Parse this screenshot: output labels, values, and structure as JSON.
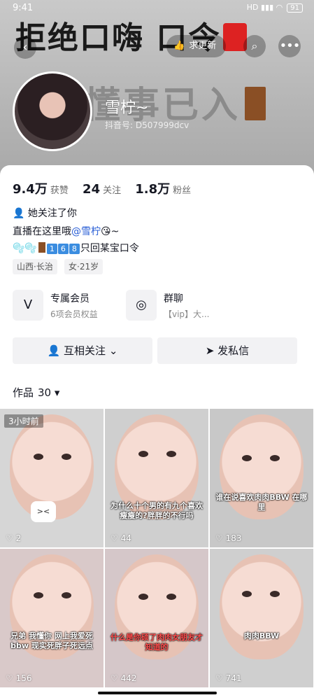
{
  "status_bar": {
    "time": "9:41",
    "signal": "HD ▮▮▮ ◠",
    "battery": "91"
  },
  "banner": {
    "text_top": "拒绝口嗨  口令",
    "text_mid": "懂事已入"
  },
  "header": {
    "update_button": "求更新",
    "back_icon": "back-arrow-icon",
    "search_icon": "search-icon",
    "more_icon": "more-icon"
  },
  "profile": {
    "nickname": "雪柠~",
    "douyin_id": "抖音号: D507999dcv"
  },
  "stats": [
    {
      "value": "9.4万",
      "label": "获赞"
    },
    {
      "value": "24",
      "label": "关注"
    },
    {
      "value": "1.8万",
      "label": "粉丝"
    }
  ],
  "follows_you": "她关注了你",
  "bio": {
    "line1_prefix": "直播在这里哦",
    "line1_at": "@雪柠",
    "line1_suffix": "😘~",
    "line2_nums": [
      "1",
      "6",
      "8"
    ],
    "line2_text": "只回某宝口令"
  },
  "tags": [
    "山西·长治",
    "女·21岁"
  ],
  "features": [
    {
      "title": "专属会员",
      "subtitle": "6项会员权益",
      "icon": "vip-icon"
    },
    {
      "title": "群聊",
      "subtitle": "【vip】大...",
      "icon": "group-chat-icon"
    }
  ],
  "actions": {
    "mutual_follow": "互相关注",
    "send_message": "发私信"
  },
  "works": {
    "label": "作品",
    "count": "30"
  },
  "videos": [
    {
      "likes": "2",
      "caption": "",
      "badge": "3小时前",
      "sticker": "><"
    },
    {
      "likes": "44",
      "caption": "为什么十个男的有九个喜欢瘦瘦的?胖胖的不行吗",
      "badge": "",
      "sticker": ""
    },
    {
      "likes": "183",
      "caption": "谁在说喜欢肉肉BBW 在哪里",
      "badge": "",
      "sticker": ""
    },
    {
      "likes": "156",
      "caption": "兄弟 我懂你 网上我爱死bbw 现实死胖子死远点",
      "badge": "",
      "sticker": ""
    },
    {
      "likes": "442",
      "caption": "什么是你硕了肉肉女朋友才知道的",
      "badge": "",
      "sticker": ""
    },
    {
      "likes": "741",
      "caption": "肉肉BBW",
      "badge": "",
      "sticker": ""
    }
  ]
}
